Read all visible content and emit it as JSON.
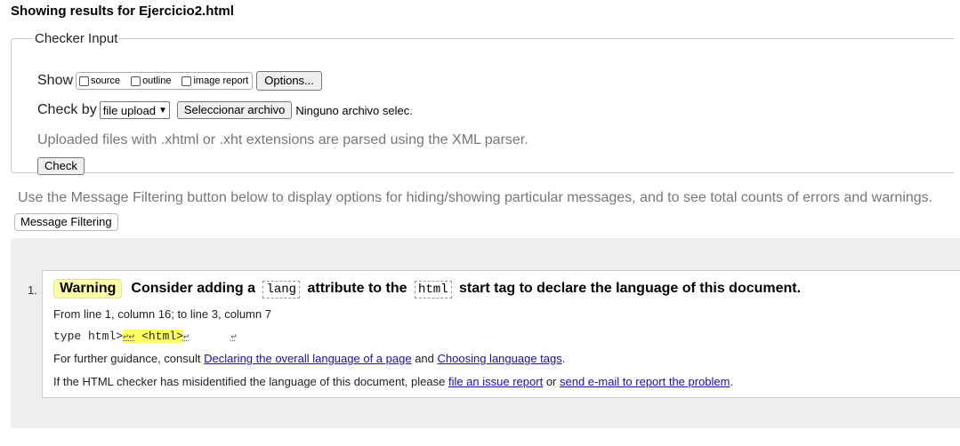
{
  "page": {
    "heading": "Showing results for Ejercicio2.html"
  },
  "checker": {
    "legend": "Checker Input",
    "show_label": "Show",
    "show_options": [
      {
        "label": "source",
        "checked": false
      },
      {
        "label": "outline",
        "checked": false
      },
      {
        "label": "image report",
        "checked": false
      }
    ],
    "options_button": "Options...",
    "check_by_label": "Check by",
    "check_by_value": "file upload",
    "file_button": "Seleccionar archivo",
    "file_status": "Ninguno archivo selec.",
    "parser_hint": "Uploaded files with .xhtml or .xht extensions are parsed using the XML parser.",
    "check_button": "Check"
  },
  "filtering": {
    "description": "Use the Message Filtering button below to display options for hiding/showing particular messages, and to see total counts of errors and warnings.",
    "button": "Message Filtering"
  },
  "messages": [
    {
      "number": "1.",
      "type": "Warning",
      "text_before": "Consider adding a",
      "code1": "lang",
      "text_middle": "attribute to the",
      "code2": "html",
      "text_after": "start tag to declare the language of this document.",
      "location": "From line 1, column 16; to line 3, column 7",
      "extract_before": "type html>",
      "extract_highlight_ret": "↩↩",
      "extract_highlight_tag": " <html>",
      "extract_ret_after": "↩",
      "extract_ret_end": "↩",
      "guidance_prefix": "For further guidance, consult",
      "guidance_link1": "Declaring the overall language of a page",
      "guidance_and": "and",
      "guidance_link2": "Choosing language tags",
      "guidance_suffix": ".",
      "misid_prefix": "If the HTML checker has misidentified the language of this document, please",
      "misid_link1": "file an issue report",
      "misid_or": "or",
      "misid_link2": "send e-mail to report the problem",
      "misid_suffix": "."
    }
  ],
  "colors": {
    "warning_badge": "#ffffa8",
    "highlight": "#ffff60",
    "link": "#1a0dab",
    "results_bg": "#eeeeee"
  }
}
